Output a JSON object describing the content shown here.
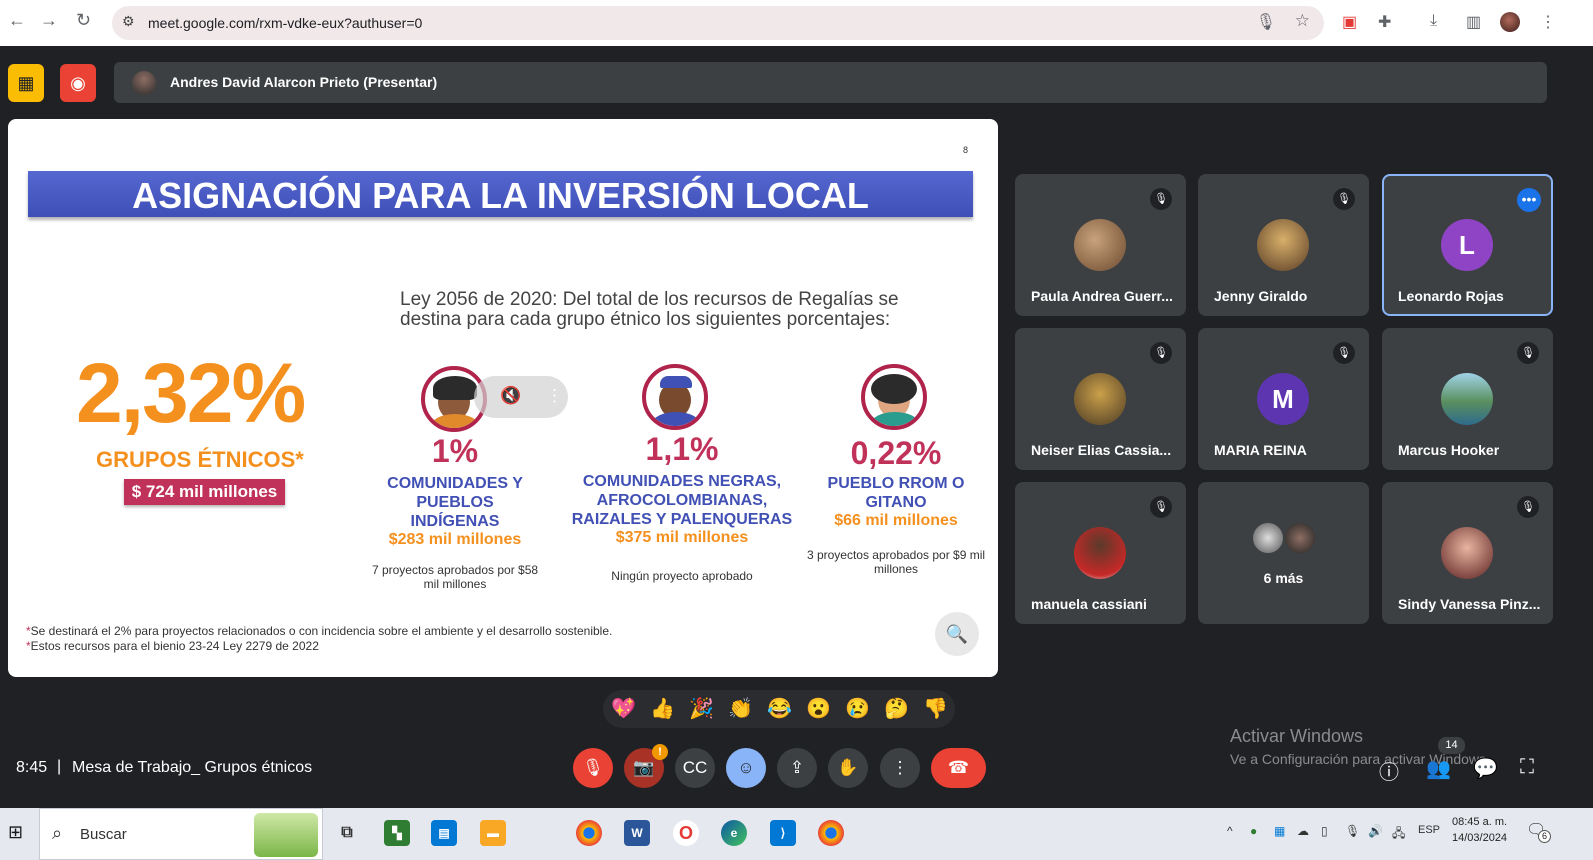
{
  "browser": {
    "url": "meet.google.com/rxm-vdke-eux?authuser=0"
  },
  "presenter": {
    "name": "Andres David Alarcon Prieto (Presentar)"
  },
  "slide": {
    "page_marker": "8",
    "title": "ASIGNACIÓN PARA LA INVERSIÓN LOCAL",
    "ley_text": "Ley 2056 de 2020: Del total de los recursos de Regalías se destina para cada grupo étnico los siguientes porcentajes:",
    "total_pct": "2,32%",
    "total_label": "GRUPOS ÉTNICOS*",
    "total_amount": "$ 724 mil millones",
    "groups": [
      {
        "pct": "1%",
        "label": "COMUNIDADES Y PUEBLOS INDÍGENAS",
        "amount": "$283 mil millones",
        "note": "7 proyectos aprobados por $58 mil millones"
      },
      {
        "pct": "1,1%",
        "label": "COMUNIDADES NEGRAS, AFROCOLOMBIANAS, RAIZALES Y PALENQUERAS",
        "amount": "$375 mil millones",
        "note": "Ningún proyecto aprobado"
      },
      {
        "pct": "0,22%",
        "label": "PUEBLO RROM O GITANO",
        "amount": "$66 mil millones",
        "note": "3 proyectos aprobados por $9 mil millones"
      }
    ],
    "footnote1": "Se destinará el 2% para proyectos relacionados o con incidencia sobre el ambiente y el desarrollo sostenible.",
    "footnote2": "Estos recursos para el bienio 23-24 Ley 2279 de 2022",
    "footnote_mark": "*"
  },
  "participants": [
    {
      "name": "Paula Andrea Guerr...",
      "muted": true
    },
    {
      "name": "Jenny Giraldo",
      "muted": true
    },
    {
      "name": "Leonardo Rojas",
      "initial": "L",
      "active": true
    },
    {
      "name": "Neiser Elias Cassia...",
      "muted": true
    },
    {
      "name": "MARIA REINA",
      "initial": "M",
      "muted": true
    },
    {
      "name": "Marcus Hooker",
      "muted": true
    },
    {
      "name": "manuela cassiani",
      "muted": true
    },
    {
      "name": "6 más"
    },
    {
      "name": "Sindy Vanessa Pinz...",
      "muted": true
    }
  ],
  "bottom": {
    "time": "8:45",
    "separator": "|",
    "meeting": "Mesa de Trabajo_ Grupos étnicos",
    "participant_count": "14"
  },
  "reactions": [
    "💖",
    "👍",
    "🎉",
    "👏",
    "😂",
    "😮",
    "😢",
    "🤔",
    "👎"
  ],
  "watermark": {
    "line1": "Activar Windows",
    "line2": "Ve a Configuración para activar Windows."
  },
  "taskbar": {
    "search": "Buscar",
    "lang": "ESP",
    "time": "08:45 a. m.",
    "date": "14/03/2024",
    "notif": "6"
  },
  "colors": {
    "accent_orange": "#f4901e",
    "accent_magenta": "#c0325a",
    "accent_blue": "#4150b4",
    "end_call": "#ea4335",
    "active_blue": "#8ab4f8"
  }
}
